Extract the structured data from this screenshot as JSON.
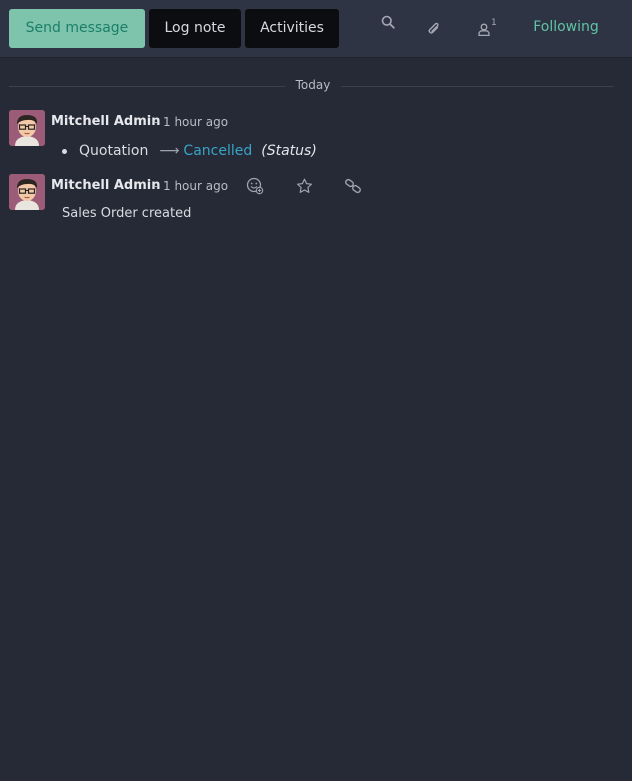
{
  "topbar": {
    "send_message": "Send message",
    "log_note": "Log note",
    "activities": "Activities",
    "follower_count": "1",
    "following": "Following"
  },
  "separator": {
    "label": "Today"
  },
  "messages": [
    {
      "author": "Mitchell Admin",
      "dash": "-",
      "date": "1 hour ago",
      "tracking": {
        "old_value": "Quotation",
        "new_value": "Cancelled",
        "field": "(Status)"
      }
    },
    {
      "author": "Mitchell Admin",
      "dash": "-",
      "date": "1 hour ago",
      "body": "Sales Order created"
    }
  ],
  "colors": {
    "background": "#262a36",
    "accent": "#5fc3a5",
    "send_button": "#7ec4ad",
    "link": "#38a4c7"
  },
  "icons": [
    "search-icon",
    "paperclip-icon",
    "user-icon",
    "add-reaction-icon",
    "star-icon",
    "link-icon"
  ]
}
